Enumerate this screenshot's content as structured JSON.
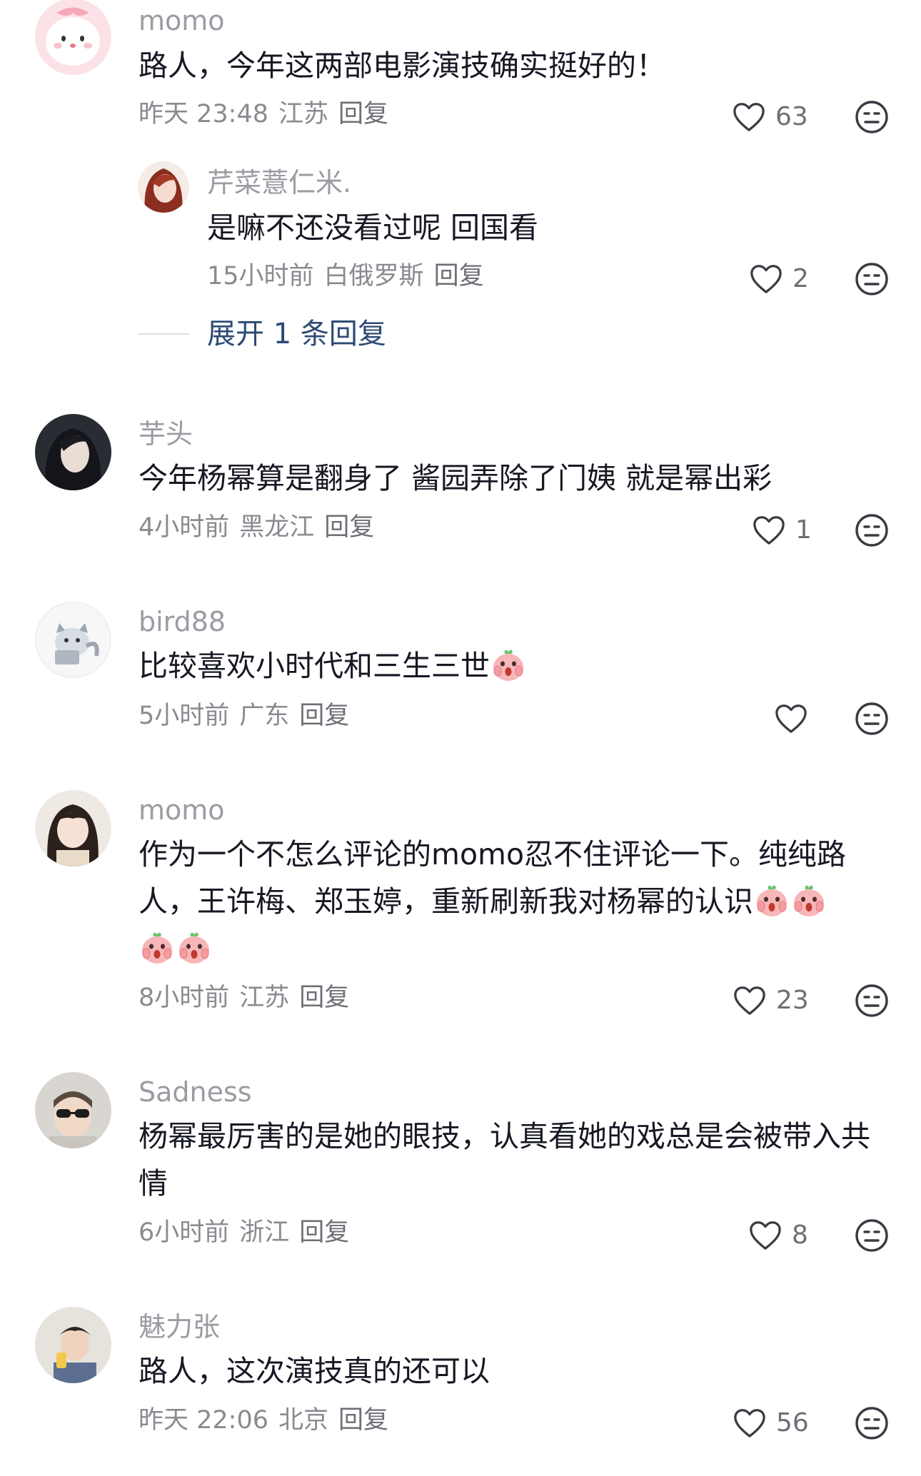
{
  "comments": [
    {
      "username": "momo",
      "text": "路人，今年这两部电影演技确实挺好的！",
      "time": "昨天 23:48",
      "location": "江苏",
      "reply_label": "回复",
      "likes": "63",
      "replies": [
        {
          "username": "芹菜薏仁米.",
          "text": "是嘛不还没看过呢 回国看",
          "time": "15小时前",
          "location": "白俄罗斯",
          "reply_label": "回复",
          "likes": "2"
        }
      ],
      "expand_label": "展开 1 条回复"
    },
    {
      "username": "芋头",
      "text": "今年杨幂算是翻身了 酱园弄除了门姨 就是幂出彩",
      "time": "4小时前",
      "location": "黑龙江",
      "reply_label": "回复",
      "likes": "1"
    },
    {
      "username": "bird88",
      "text": "比较喜欢小时代和三生三世",
      "time": "5小时前",
      "location": "广东",
      "reply_label": "回复",
      "likes": ""
    },
    {
      "username": "momo",
      "text_line1": "作为一个不怎么评论的momo忍不住评论一下。纯纯路",
      "text_line2": "人，王许梅、郑玉婷，重新刷新我对杨幂的认识",
      "time": "8小时前",
      "location": "江苏",
      "reply_label": "回复",
      "likes": "23"
    },
    {
      "username": "Sadness",
      "text": "杨幂最厉害的是她的眼技，认真看她的戏总是会被带入共情",
      "time": "6小时前",
      "location": "浙江",
      "reply_label": "回复",
      "likes": "8"
    },
    {
      "username": "魅力张",
      "text": "路人，这次演技真的还可以",
      "time": "昨天 22:06",
      "location": "北京",
      "reply_label": "回复",
      "likes": "56"
    }
  ],
  "icons": {
    "like": "heart-outline-icon",
    "dislike": "meh-face-icon",
    "emoji": "shocked-peach-emoji"
  },
  "colors": {
    "username": "#9b9ca3",
    "text": "#161823",
    "meta": "#8a8b91",
    "expand": "#2d4a73"
  }
}
